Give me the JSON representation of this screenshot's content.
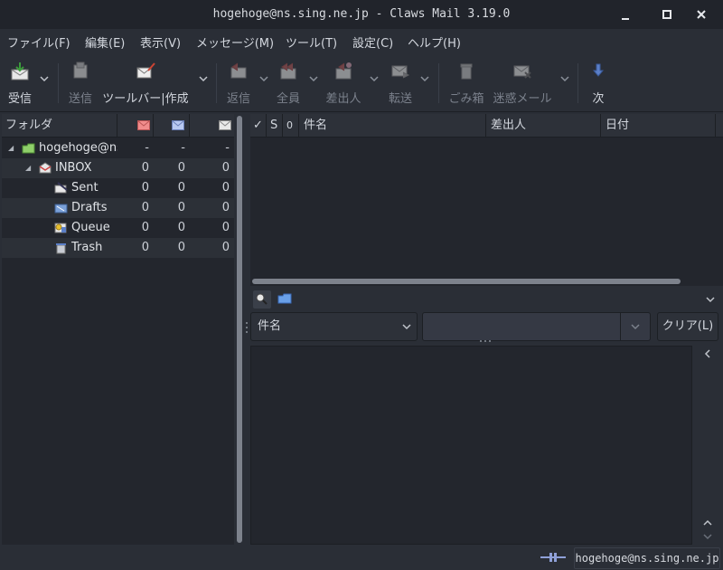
{
  "window": {
    "title": "hogehoge@ns.sing.ne.jp - Claws Mail 3.19.0",
    "minimize": "—",
    "maximize": "□",
    "close": "✕"
  },
  "menu": [
    "ファイル(F)",
    "編集(E)",
    "表示(V)",
    "メッセージ(M)",
    "ツール(T)",
    "設定(C)",
    "ヘルプ(H)"
  ],
  "toolbar": {
    "receive": "受信",
    "send": "送信",
    "compose": "ツールバー|作成",
    "reply": "返信",
    "reply_all": "全員",
    "reply_sender": "差出人",
    "forward": "転送",
    "trash": "ごみ箱",
    "spam": "迷惑メール",
    "next": "次"
  },
  "folder_pane": {
    "header": "フォルダ",
    "rows": [
      {
        "name": "hogehoge@ns.sing.ne.jp",
        "new": "-",
        "unread": "-",
        "total": "-"
      },
      {
        "name": "INBOX",
        "new": "0",
        "unread": "0",
        "total": "0"
      },
      {
        "name": "Sent",
        "new": "0",
        "unread": "0",
        "total": "0"
      },
      {
        "name": "Drafts",
        "new": "0",
        "unread": "0",
        "total": "0"
      },
      {
        "name": "Queue",
        "new": "0",
        "unread": "0",
        "total": "0"
      },
      {
        "name": "Trash",
        "new": "0",
        "unread": "0",
        "total": "0"
      }
    ]
  },
  "message_list": {
    "columns": {
      "mark": "✓",
      "status": "S",
      "attach": "0",
      "subject": "件名",
      "from": "差出人",
      "date": "日付"
    }
  },
  "quick_search": {
    "field": "件名",
    "value": "",
    "clear": "クリア(L)"
  },
  "statusbar": {
    "account": "hogehoge@ns.sing.ne.jp"
  },
  "colors": {
    "background": "#2a2e36",
    "pane": "#23262d",
    "header": "#2d3139",
    "scrollbar": "#7d828c"
  }
}
